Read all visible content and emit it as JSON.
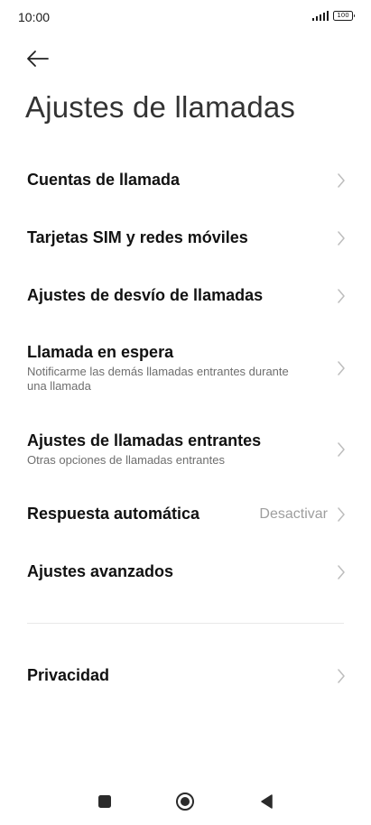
{
  "status_bar": {
    "time": "10:00",
    "signal_icon": "signal-bars-icon",
    "battery_level": "100"
  },
  "header": {
    "back_icon": "arrow-left-icon",
    "title": "Ajustes de llamadas"
  },
  "items": [
    {
      "title": "Cuentas de llamada",
      "subtitle": "",
      "value": ""
    },
    {
      "title": "Tarjetas SIM y redes móviles",
      "subtitle": "",
      "value": ""
    },
    {
      "title": "Ajustes de desvío de llamadas",
      "subtitle": "",
      "value": ""
    },
    {
      "title": "Llamada en espera",
      "subtitle": "Notificarme las demás llamadas entrantes durante una llamada",
      "value": ""
    },
    {
      "title": "Ajustes de llamadas entrantes",
      "subtitle": "Otras opciones de llamadas entrantes",
      "value": ""
    },
    {
      "title": "Respuesta automática",
      "subtitle": "",
      "value": "Desactivar"
    },
    {
      "title": "Ajustes avanzados",
      "subtitle": "",
      "value": ""
    },
    {
      "title": "Privacidad",
      "subtitle": "",
      "value": ""
    }
  ],
  "nav_bar": {
    "recents_icon": "square-icon",
    "home_icon": "circle-home-icon",
    "back_icon": "triangle-back-icon"
  },
  "colors": {
    "title_text": "#111111",
    "subtitle_text": "#6e6e6e",
    "value_text": "#9e9e9e",
    "chevron": "#bdbdbd",
    "nav_icons": "#2b2b2b"
  }
}
